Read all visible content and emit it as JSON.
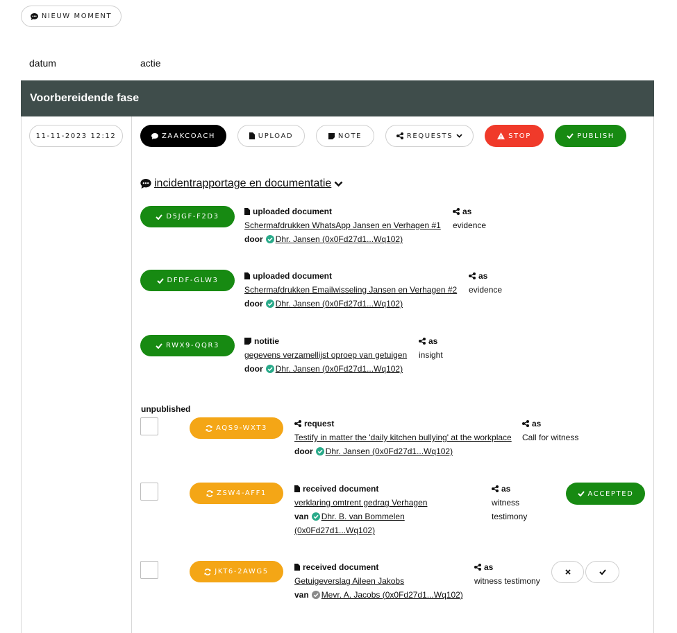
{
  "top_button": {
    "label": "NIEUW MOMENT",
    "icon": "comment-dots-icon"
  },
  "columns": {
    "date": "datum",
    "action": "actie"
  },
  "phase": {
    "title": "Voorbereidende fase"
  },
  "moment": {
    "datetime": "11-11-2023 12:12"
  },
  "toolbar": {
    "zaakcoach": "ZAAKCOACH",
    "upload": "UPLOAD",
    "note": "NOTE",
    "requests": "REQUESTS",
    "stop": "STOP",
    "publish": "PUBLISH"
  },
  "section": {
    "title": "incidentrapportage en documentatie"
  },
  "published": [
    {
      "code": "D5JGF-F2D3",
      "type": "uploaded document",
      "link": "Schermafdrukken WhatsApp Jansen en Verhagen #1",
      "by_label": "door",
      "by": " Dhr. Jansen (0x0Fd27d1...Wq102)",
      "as_label": "as",
      "as_value": "evidence"
    },
    {
      "code": "DFDF-GLW3",
      "type": "uploaded document",
      "link": "Schermafdrukken Emailwisseling Jansen en Verhagen #2",
      "by_label": "door",
      "by": " Dhr. Jansen (0x0Fd27d1...Wq102)",
      "as_label": "as",
      "as_value": "evidence"
    },
    {
      "code": "RWX9-QQR3",
      "type": "notitie",
      "link": "gegevens verzamellijst oproep van getuigen",
      "by_label": "door",
      "by": " Dhr. Jansen (0x0Fd27d1...Wq102)",
      "as_label": "as",
      "as_value": "insight"
    }
  ],
  "unpublished_label": "unpublished",
  "unpublished": [
    {
      "code": "AQS9-WXT3",
      "type": "request",
      "link": "Testify in matter the 'daily kitchen bullying' at the workplace",
      "by_label": "door",
      "by": " Dhr. Jansen (0x0Fd27d1...Wq102)",
      "as_label": "as",
      "as_value": "Call for witness"
    },
    {
      "code": "ZSW4-AFF1",
      "type": "received document",
      "link": "verklaring omtrent gedrag Verhagen",
      "by_label": "van",
      "by": " Dhr. B. van Bommelen",
      "by_line2": "(0x0Fd27d1...Wq102)",
      "as_label": "as",
      "as_value_1": "witness",
      "as_value_2": "testimony",
      "status": "ACCEPTED"
    },
    {
      "code": "JKT6-2AWG5",
      "type": "received document",
      "link": "Getuigeverslag Aileen Jakobs",
      "by_label": "van",
      "by": " Mevr. A. Jacobs (0x0Fd27d1...Wq102)",
      "as_label": "as",
      "as_value": "witness testimony"
    }
  ],
  "colors": {
    "phase_bg": "#3f4d4b",
    "green": "#178a12",
    "orange": "#f4a616",
    "red": "#f03a2a",
    "verified": "#2aaa8a",
    "unverified": "#8a8a8a"
  }
}
